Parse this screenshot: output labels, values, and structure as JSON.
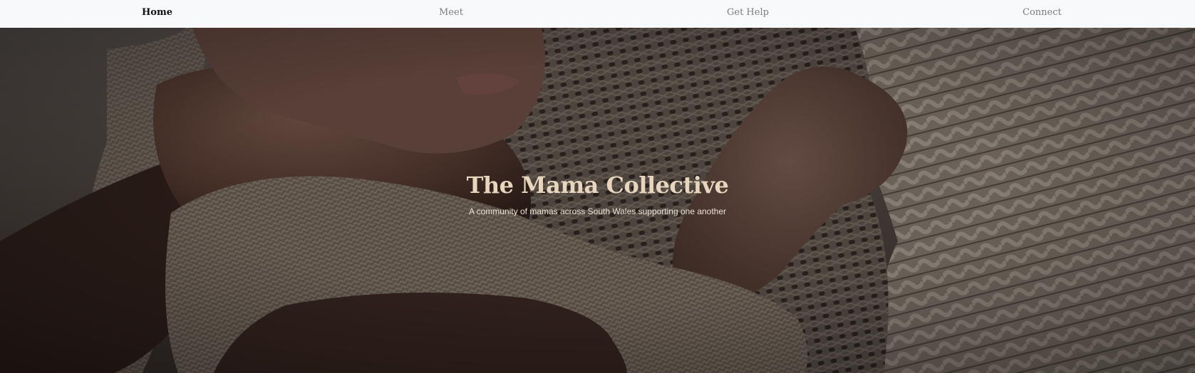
{
  "nav": {
    "items": [
      {
        "label": "Home",
        "active": true
      },
      {
        "label": "Meet",
        "active": false
      },
      {
        "label": "Get Help",
        "active": false
      },
      {
        "label": "Connect",
        "active": false
      }
    ]
  },
  "hero": {
    "title": "The Mama Collective",
    "subtitle": "A community of mamas across South Wales supporting one another",
    "image": "baby-in-knit-blanket-photo"
  },
  "colors": {
    "nav_background": "#f8f9fa",
    "nav_active": "#111111",
    "nav_inactive": "#7c7c7c",
    "title": "#e7d6bd",
    "subtitle": "#ece3d6"
  }
}
